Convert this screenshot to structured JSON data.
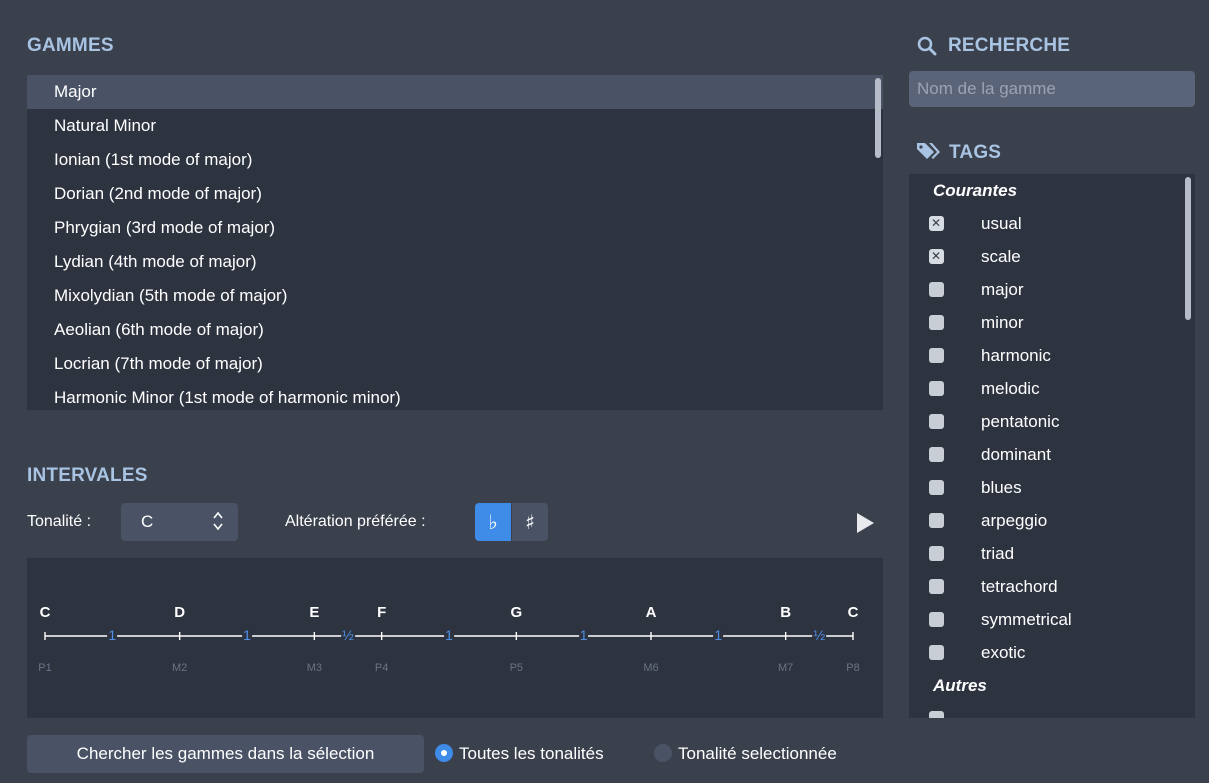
{
  "scales": {
    "heading": "GAMMES",
    "items": [
      "Major",
      "Natural Minor",
      "Ionian (1st mode of major)",
      "Dorian (2nd mode of major)",
      "Phrygian (3rd mode of major)",
      "Lydian (4th mode of major)",
      "Mixolydian (5th mode of major)",
      "Aeolian (6th mode of major)",
      "Locrian (7th mode of major)",
      "Harmonic Minor (1st mode of harmonic minor)"
    ],
    "selected": "Major"
  },
  "intervals": {
    "heading": "INTERVALES",
    "tonality_label": "Tonalité :",
    "tonality_value": "C",
    "alteration_label": "Altération préférée :",
    "flat_symbol": "♭",
    "sharp_symbol": "♯",
    "alteration_selected": "flat",
    "notes": [
      "C",
      "D",
      "E",
      "F",
      "G",
      "A",
      "B",
      "C"
    ],
    "steps": [
      "1",
      "1",
      "½",
      "1",
      "1",
      "1",
      "½"
    ],
    "degrees": [
      "P1",
      "M2",
      "M3",
      "P4",
      "P5",
      "M6",
      "M7",
      "P8"
    ]
  },
  "bottom_bar": {
    "search_button": "Chercher les gammes dans la sélection",
    "radio_all": "Toutes les tonalités",
    "radio_selected": "Tonalité selectionnée",
    "radio_checked": "all"
  },
  "search": {
    "heading": "RECHERCHE",
    "placeholder": "Nom de la gamme"
  },
  "tags": {
    "heading": "TAGS",
    "group_common": "Courantes",
    "items": [
      {
        "name": "usual",
        "checked": true
      },
      {
        "name": "scale",
        "checked": true
      },
      {
        "name": "major",
        "checked": false
      },
      {
        "name": "minor",
        "checked": false
      },
      {
        "name": "harmonic",
        "checked": false
      },
      {
        "name": "melodic",
        "checked": false
      },
      {
        "name": "pentatonic",
        "checked": false
      },
      {
        "name": "dominant",
        "checked": false
      },
      {
        "name": "blues",
        "checked": false
      },
      {
        "name": "arpeggio",
        "checked": false
      },
      {
        "name": "triad",
        "checked": false
      },
      {
        "name": "tetrachord",
        "checked": false
      },
      {
        "name": "symmetrical",
        "checked": false
      },
      {
        "name": "exotic",
        "checked": false
      }
    ],
    "group_other": "Autres"
  },
  "colors": {
    "background": "#3a404c",
    "panel": "#2e3340",
    "heading": "#a9c3e3",
    "accent": "#3f8ce8",
    "step_text": "#4f8fe6"
  },
  "icons": {
    "search": "search-icon",
    "tag": "tag-icon",
    "play": "play-icon",
    "select_arrows": "chevron-updown-icon"
  }
}
